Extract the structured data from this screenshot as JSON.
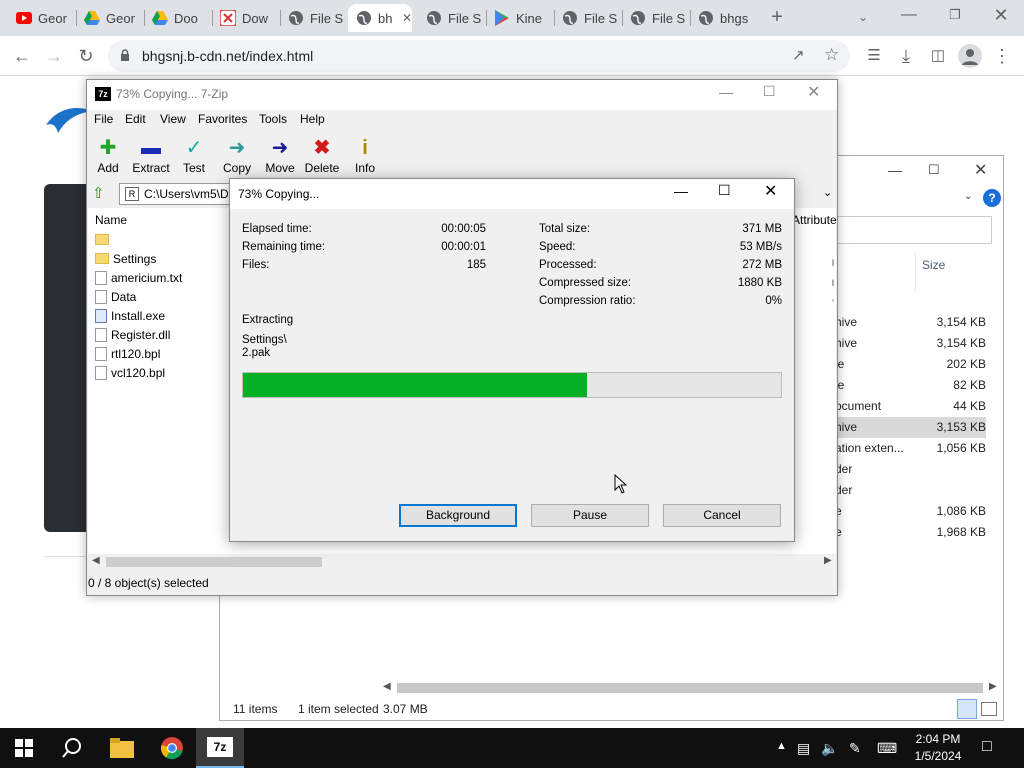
{
  "browser": {
    "tabs": [
      {
        "label": "Geor",
        "icon": "youtube-icon"
      },
      {
        "label": "Geor",
        "icon": "drive-icon"
      },
      {
        "label": "Doo",
        "icon": "drive-icon"
      },
      {
        "label": "Dow",
        "icon": "download-site-icon"
      },
      {
        "label": "File S",
        "icon": "globe-icon"
      },
      {
        "label": "bh",
        "icon": "globe-icon"
      },
      {
        "label": "File S",
        "icon": "globe-icon"
      },
      {
        "label": "Kine",
        "icon": "play-store-icon"
      },
      {
        "label": "File S",
        "icon": "globe-icon"
      },
      {
        "label": "File S",
        "icon": "globe-icon"
      },
      {
        "label": "bhgs",
        "icon": "globe-icon"
      }
    ],
    "url": "bhgsnj.b-cdn.net/index.html"
  },
  "zip": {
    "title": "73% Copying... 7-Zip",
    "menu": [
      "File",
      "Edit",
      "View",
      "Favorites",
      "Tools",
      "Help"
    ],
    "toolbar": [
      "Add",
      "Extract",
      "Test",
      "Copy",
      "Move",
      "Delete",
      "Info"
    ],
    "path": "C:\\Users\\vm5\\De",
    "col_name": "Name",
    "col_attr": "Attribute",
    "files": [
      "",
      "Settings",
      "americium.txt",
      "Data",
      "Install.exe",
      "Register.dll",
      "rtl120.bpl",
      "vcl120.bpl"
    ],
    "status": "0 / 8 object(s) selected"
  },
  "dialog": {
    "title": "73% Copying...",
    "elapsed_label": "Elapsed time:",
    "elapsed": "00:00:05",
    "remaining_label": "Remaining time:",
    "remaining": "00:00:01",
    "files_label": "Files:",
    "files": "185",
    "total_label": "Total size:",
    "total": "371 MB",
    "speed_label": "Speed:",
    "speed": "53 MB/s",
    "processed_label": "Processed:",
    "processed": "272 MB",
    "compressed_label": "Compressed size:",
    "compressed": "1880 KB",
    "ratio_label": "Compression ratio:",
    "ratio": "0%",
    "action": "Extracting",
    "current_file_1": "Settings\\",
    "current_file_2": "2.pak",
    "progress": 0.64,
    "btn_background": "Background",
    "btn_pause": "Pause",
    "btn_cancel": "Cancel"
  },
  "explorer": {
    "col_size": "Size",
    "rows": [
      {
        "type": "hive",
        "size": "3,154 KB"
      },
      {
        "type": "hive",
        "size": "3,154 KB"
      },
      {
        "type": "le",
        "size": "202 KB"
      },
      {
        "type": "le",
        "size": "82 KB"
      },
      {
        "type": "ocument",
        "size": "44 KB"
      },
      {
        "type": "hive",
        "size": "3,153 KB"
      },
      {
        "type": "ation exten...",
        "size": "1,056 KB"
      },
      {
        "type": "der",
        "size": ""
      },
      {
        "type": "der",
        "size": ""
      },
      {
        "type": "e",
        "size": "1,086 KB"
      },
      {
        "type": "e",
        "size": "1,968 KB"
      }
    ],
    "items_count": "11 items",
    "selected": "1 item selected",
    "selected_size": "3.07 MB"
  },
  "taskbar": {
    "time": "2:04 PM",
    "date": "1/5/2024"
  }
}
